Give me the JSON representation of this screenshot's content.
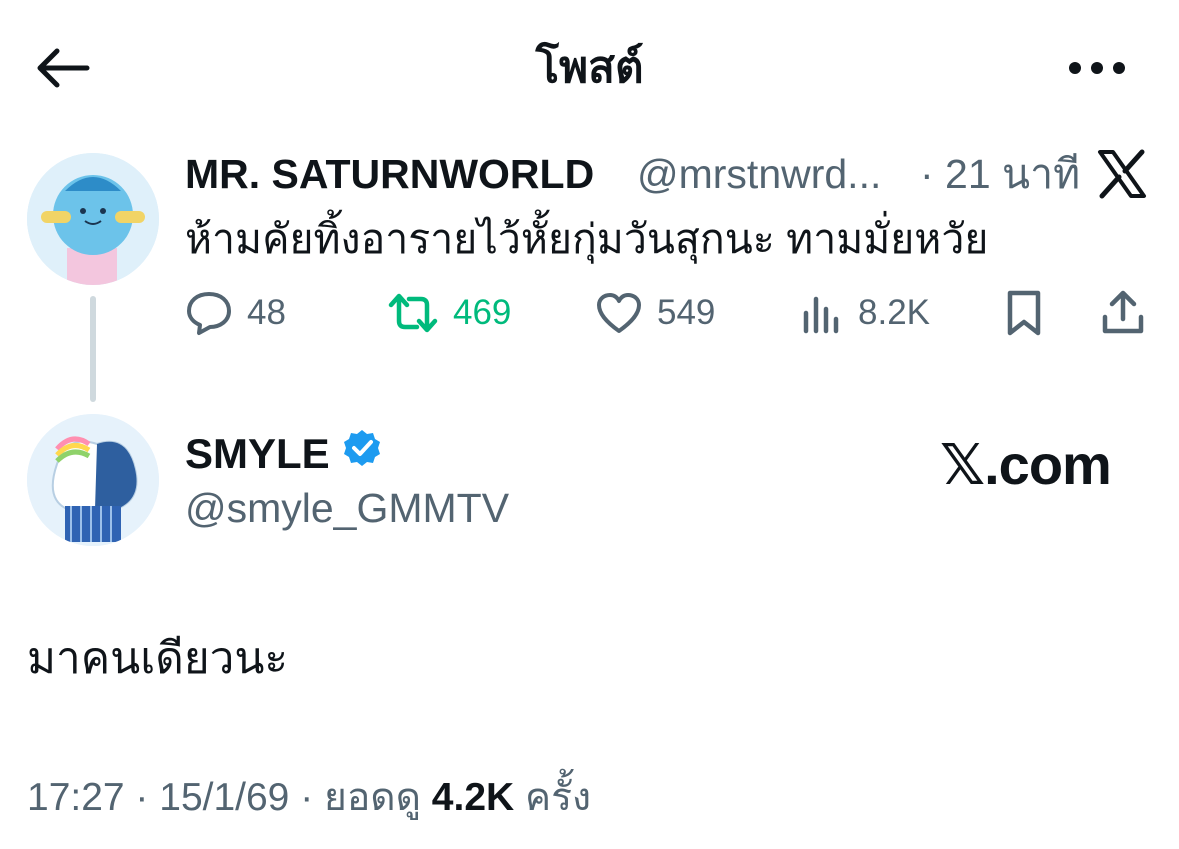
{
  "header": {
    "title": "โพสต์",
    "back_icon": "arrow-left-icon",
    "more_icon": "more-horizontal-icon"
  },
  "parent_tweet": {
    "display_name": "MR. SATURNWORLD",
    "handle": "@mrstnwrd...",
    "time": "· 21 นาที",
    "text": "ห้ามคัยทิ้งอารายไว้หั้ยกุ่มวันสุกนะ ทามมั่ยหวัย",
    "actions": {
      "replies": "48",
      "reposts": "469",
      "likes": "549",
      "views": "8.2K"
    }
  },
  "main_tweet": {
    "display_name": "SMYLE",
    "handle": "@smyle_GMMTV",
    "watermark": "𝕏.com",
    "text": "มาคนเดียวนะ",
    "timestamp": "17:27 · 15/1/69 · ยอดดู ",
    "views_count": "4.2K",
    "views_suffix": " ครั้ง"
  },
  "colors": {
    "text": "#0f1419",
    "secondary": "#536471",
    "repost_green": "#00ba7c",
    "verified_blue": "#1d9bf0"
  }
}
